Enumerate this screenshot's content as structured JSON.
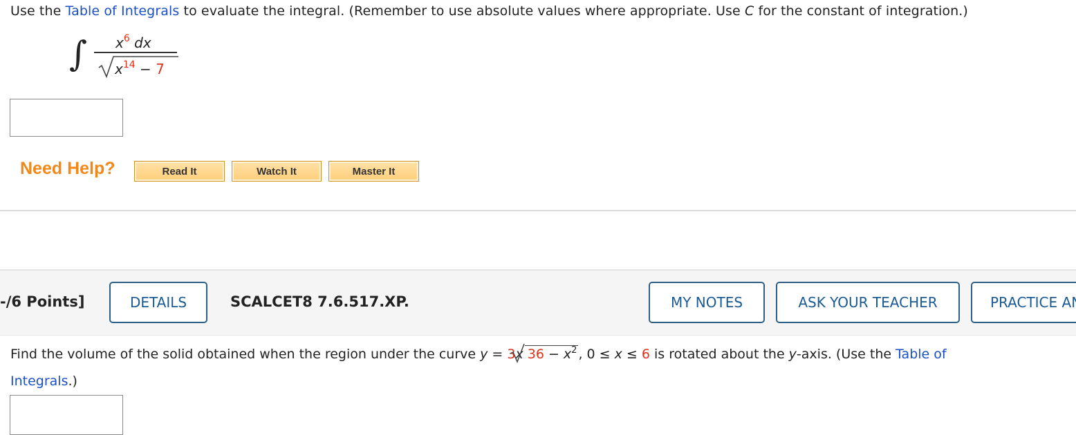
{
  "question1": {
    "prefix": "Use the ",
    "link": "Table of Integrals",
    "middle": " to evaluate the integral. (Remember to use absolute values where appropriate. Use ",
    "var_c": "C",
    "suffix": " for the constant of integration.)",
    "integral": {
      "sign": "∫",
      "numerator_base": "x",
      "numerator_exponent": "6",
      "numerator_dx": " dx",
      "denominator_base": "x",
      "denominator_exponent": "14",
      "denominator_minus": " − ",
      "denominator_constant": "7"
    },
    "answer_value": ""
  },
  "help": {
    "label": "Need Help?",
    "read_it": "Read It",
    "watch_it": "Watch It",
    "master_it": "Master It"
  },
  "question2": {
    "points": "-/6 Points]",
    "details_button": "DETAILS",
    "problem_code": "SCALCET8 7.6.517.XP.",
    "my_notes_button": "MY NOTES",
    "ask_teacher_button": "ASK YOUR TEACHER",
    "practice_button": "PRACTICE ANOTHER",
    "text_before": "Find the volume of the solid obtained when the region under the curve  ",
    "eq_y": "y",
    "eq_equals": " = ",
    "eq_coef": "3",
    "eq_x": "x",
    "radicand_const": "36",
    "radicand_minus": " − ",
    "radicand_x": "x",
    "radicand_exp": "2",
    "domain_sep": ",  ",
    "domain_low": "0",
    "domain_mid": " ≤ ",
    "domain_var": "x",
    "domain_le": " ≤ ",
    "domain_high": "6",
    "text_after": "  is rotated about the ",
    "axis_var": "y",
    "axis_suffix": "-axis. (Use the ",
    "link_part1": "Table of",
    "link_part2": "Integrals",
    "closing": ".)",
    "answer_value": ""
  }
}
